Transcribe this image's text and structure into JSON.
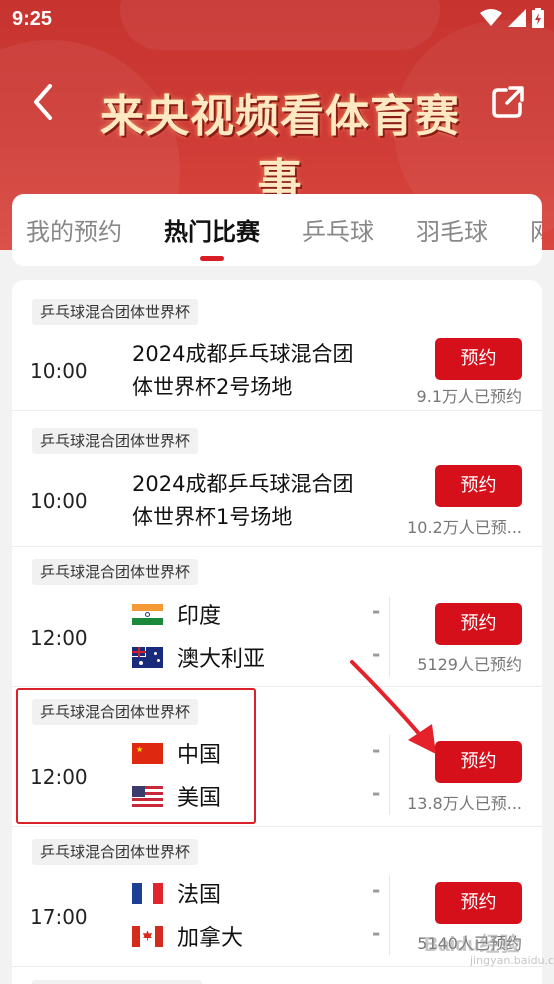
{
  "status": {
    "time": "9:25"
  },
  "header": {
    "title": "来央视频看体育赛事"
  },
  "tabs": [
    {
      "label": "我的预约"
    },
    {
      "label": "热门比赛"
    },
    {
      "label": "乒乓球"
    },
    {
      "label": "羽毛球"
    },
    {
      "label": "网"
    }
  ],
  "matches": [
    {
      "tag": "乒乓球混合团体世界杯",
      "time": "10:00",
      "title_line1": "2024成都乒乓球混合团",
      "title_line2": "体世界杯2号场地",
      "button": "预约",
      "count": "9.1万人已预约"
    },
    {
      "tag": "乒乓球混合团体世界杯",
      "time": "10:00",
      "title_line1": "2024成都乒乓球混合团",
      "title_line2": "体世界杯1号场地",
      "button": "预约",
      "count": "10.2万人已预..."
    },
    {
      "tag": "乒乓球混合团体世界杯",
      "time": "12:00",
      "team1": "印度",
      "team2": "澳大利亚",
      "score1": "-",
      "score2": "-",
      "button": "预约",
      "count": "5129人已预约"
    },
    {
      "tag": "乒乓球混合团体世界杯",
      "time": "12:00",
      "team1": "中国",
      "team2": "美国",
      "score1": "-",
      "score2": "-",
      "button": "预约",
      "count": "13.8万人已预..."
    },
    {
      "tag": "乒乓球混合团体世界杯",
      "time": "17:00",
      "team1": "法国",
      "team2": "加拿大",
      "score1": "-",
      "score2": "-",
      "button": "预约",
      "count": "5140人已预约"
    }
  ],
  "watermark": {
    "text": "Baidu经验",
    "sub": "jingyan.baidu.com"
  },
  "colors": {
    "brand_red": "#d5101b",
    "header_red": "#c7332f",
    "annotation_red": "#d9212a"
  },
  "icons": {
    "back": "chevron-left-icon",
    "share": "share-icon",
    "wifi": "wifi-icon",
    "signal": "signal-icon",
    "battery": "battery-icon"
  }
}
